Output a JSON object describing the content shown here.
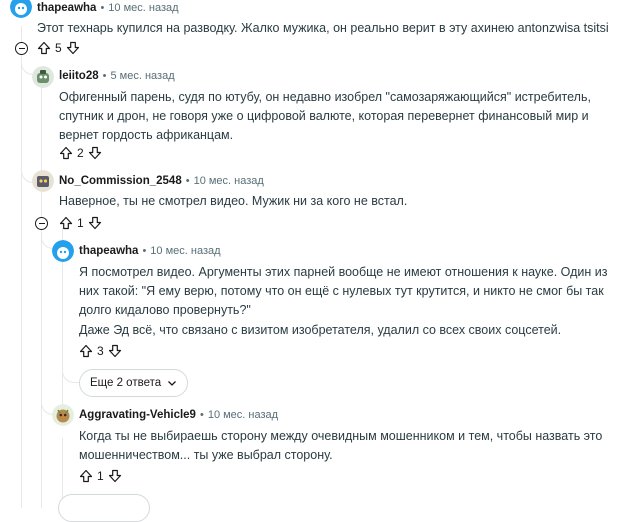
{
  "comments": [
    {
      "user": "thapeawha",
      "time": "10 мес. назад",
      "text": "Этот технарь купился на разводку. Жалко мужика, он реально верит в эту ахинею antonzwisa tsitsi",
      "votes": "5"
    },
    {
      "user": "leiito28",
      "time": "5 мес. назад",
      "text": "Офигенный парень, судя по ютубу, он недавно изобрел \"самозаряжающийся\" истребитель, спутник и дрон, не говоря уже о цифровой валюте, которая перевернет финансовый мир и вернет гордость африканцам.",
      "votes": "2"
    },
    {
      "user": "No_Commission_2548",
      "time": "10 мес. назад",
      "text": "Наверное, ты не смотрел видео. Мужик ни за кого не встал.",
      "votes": "1"
    },
    {
      "user": "thapeawha",
      "time": "10 мес. назад",
      "text": "Я посмотрел видео. Аргументы этих парней вообще не имеют отношения к науке. Один из них такой: \"Я ему верю, потому что он ещё с нулевых тут крутится, и никто не смог бы так долго кидалово провернуть?\"",
      "text2": "Даже Эд всё, что связано с визитом изобретателя, удалил со всех своих соцсетей.",
      "votes": "3"
    },
    {
      "user": "Aggravating-Vehicle9",
      "time": "10 мес. назад",
      "text": "Когда ты не выбираешь сторону между очевидным мошенником и тем, чтобы назвать это мошенничеством... ты уже выбрал сторону.",
      "votes": "1"
    }
  ],
  "more_replies": {
    "label": "Еще 2 ответа"
  },
  "separator": "•"
}
